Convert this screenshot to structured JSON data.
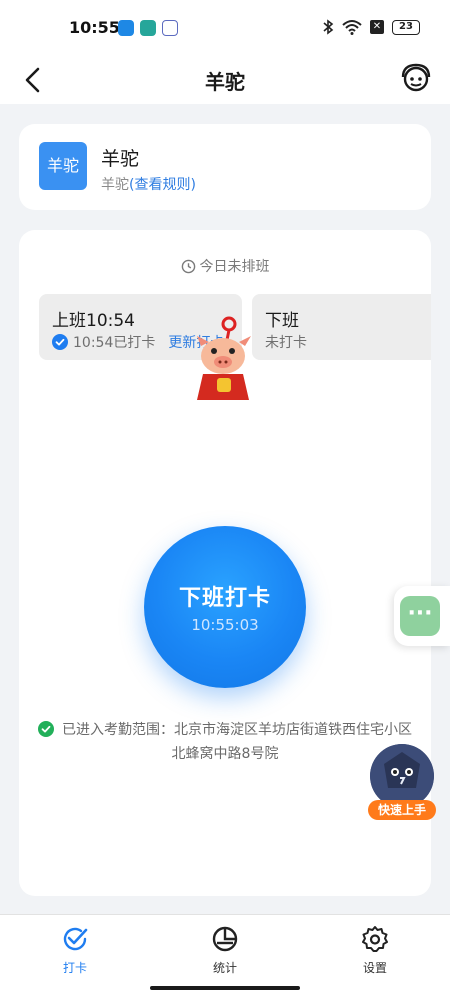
{
  "status_bar": {
    "time": "10:55",
    "battery": "23",
    "icons": [
      "bluetooth-icon",
      "wifi-icon",
      "x-badge-icon",
      "battery-icon"
    ]
  },
  "header": {
    "title": "羊驼",
    "back_icon": "chevron-left-icon",
    "service_icon": "headset-icon"
  },
  "group": {
    "avatar_text": "羊驼",
    "name": "羊驼",
    "subtitle_prefix": "羊驼",
    "rule_link": "(查看规则)"
  },
  "attendance": {
    "schedule_note": "今日未排班",
    "shift_in": {
      "title": "上班10:54",
      "status": "10:54已打卡",
      "update_link": "更新打卡"
    },
    "shift_out": {
      "title": "下班",
      "status": "未打卡"
    },
    "punch": {
      "label": "下班打卡",
      "time": "10:55:03"
    },
    "location": "已进入考勤范围：北京市海淀区羊坊店街道铁西住宅小区北蜂窝中路8号院"
  },
  "floating": {
    "chat_icon": "more-dots-icon",
    "quick_start_label": "快速上手"
  },
  "tabs": [
    {
      "label": "打卡",
      "icon": "check-icon",
      "active": true
    },
    {
      "label": "统计",
      "icon": "pie-chart-icon",
      "active": false
    },
    {
      "label": "设置",
      "icon": "gear-icon",
      "active": false
    }
  ],
  "colors": {
    "accent": "#1f7df0",
    "avatar": "#3a91f2",
    "success": "#22b05a",
    "quick_start": "#ff7a1a"
  }
}
